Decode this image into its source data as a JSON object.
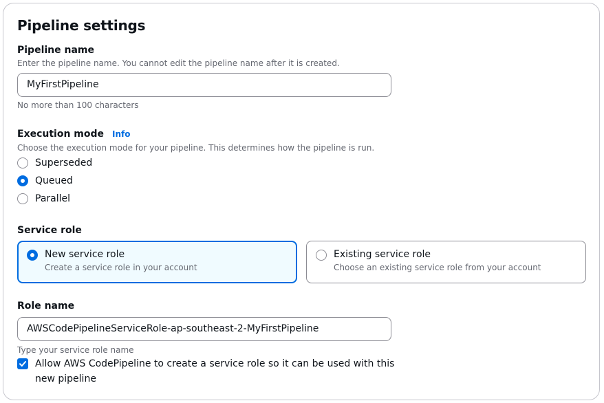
{
  "panel": {
    "title": "Pipeline settings"
  },
  "pipeline_name": {
    "label": "Pipeline name",
    "description": "Enter the pipeline name. You cannot edit the pipeline name after it is created.",
    "value": "MyFirstPipeline",
    "constraint": "No more than 100 characters"
  },
  "execution_mode": {
    "label": "Execution mode",
    "info_link": "Info",
    "description": "Choose the execution mode for your pipeline. This determines how the pipeline is run.",
    "options": [
      {
        "label": "Superseded",
        "selected": false
      },
      {
        "label": "Queued",
        "selected": true
      },
      {
        "label": "Parallel",
        "selected": false
      }
    ]
  },
  "service_role": {
    "label": "Service role",
    "options": [
      {
        "title": "New service role",
        "description": "Create a service role in your account",
        "selected": true
      },
      {
        "title": "Existing service role",
        "description": "Choose an existing service role from your account",
        "selected": false
      }
    ]
  },
  "role_name": {
    "label": "Role name",
    "value": "AWSCodePipelineServiceRole-ap-southeast-2-MyFirstPipeline",
    "hint": "Type your service role name",
    "checkbox_label": "Allow AWS CodePipeline to create a service role so it can be used with this new pipeline",
    "checkbox_checked": true
  },
  "colors": {
    "accent": "#006ce0",
    "selected_card_bg": "#f0fbff",
    "border": "#8c8c94",
    "muted_text": "#656871"
  }
}
